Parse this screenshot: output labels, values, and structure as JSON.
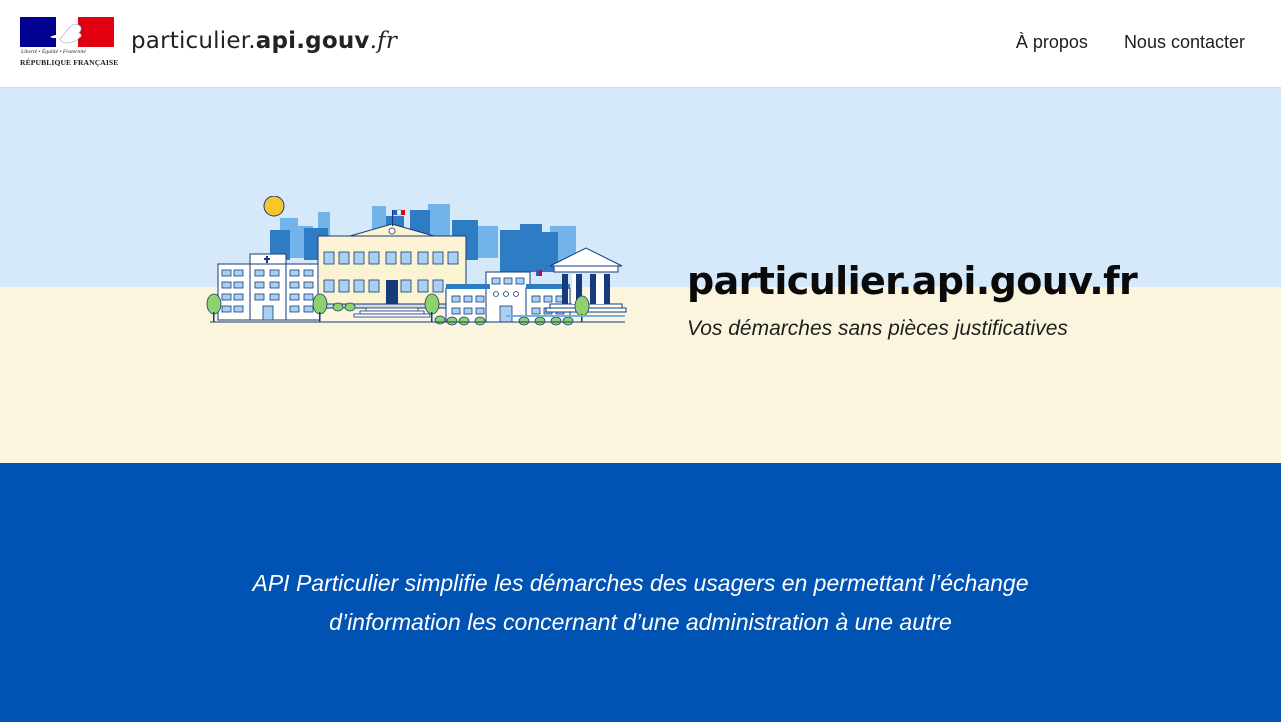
{
  "header": {
    "logo": {
      "motto": "Liberté • Égalité • Fraternité",
      "republic": "RÉPUBLIQUE FRANÇAISE",
      "colors": {
        "blue": "#000091",
        "white": "#ffffff",
        "red": "#e1000f"
      }
    },
    "site_title": {
      "prefix": "particulier.",
      "bold": "api.gouv",
      "suffix": ".fr"
    },
    "nav": [
      {
        "label": "À propos"
      },
      {
        "label": "Nous contacter"
      }
    ]
  },
  "hero": {
    "title": "particulier.api.gouv.fr",
    "subtitle": "Vos démarches sans pièces justificatives",
    "illustration": "city-buildings-illustration",
    "colors": {
      "top": "#d6e9fb",
      "bottom": "#fbf5de"
    }
  },
  "band": {
    "line1": "API Particulier simplifie les démarches des usagers en permettant l’échange",
    "line2": "d’information les concernant d’une administration à une autre",
    "color": "#0053b3"
  }
}
